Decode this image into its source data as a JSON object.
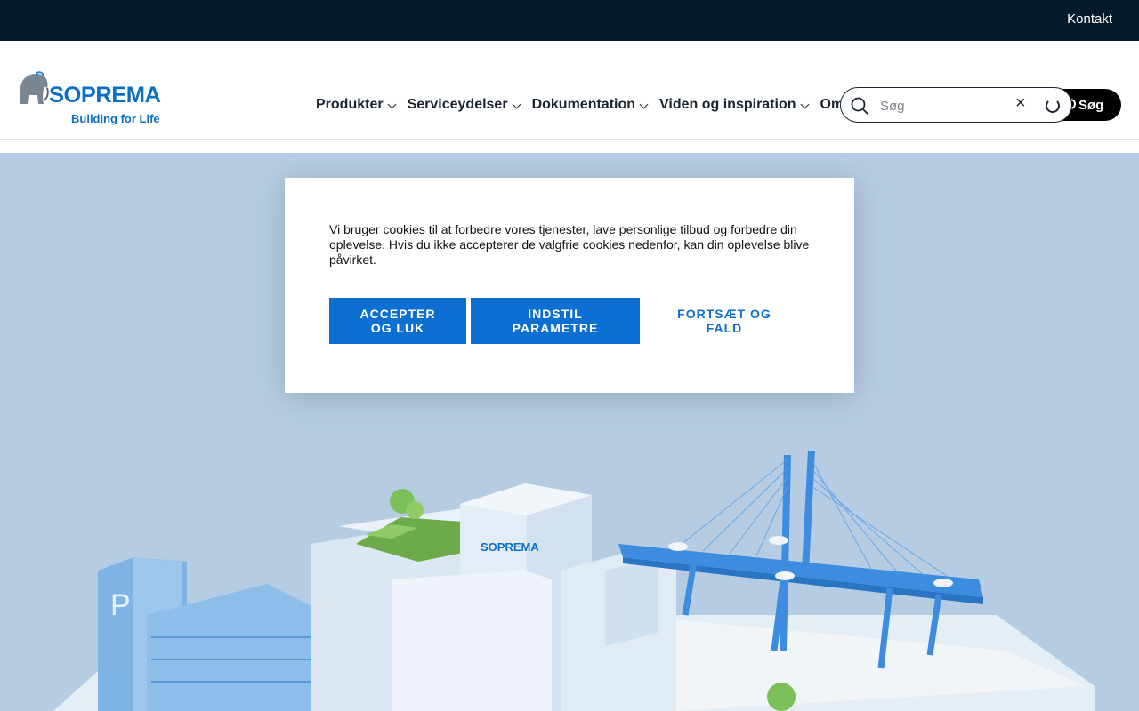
{
  "topbar": {
    "contact_label": "Kontakt"
  },
  "brand": {
    "name": "SOPREMA",
    "tagline": "Building for Life"
  },
  "nav": {
    "items": [
      {
        "label": "Produkter"
      },
      {
        "label": "Serviceydelser"
      },
      {
        "label": "Dokumentation"
      },
      {
        "label": "Viden og inspiration"
      },
      {
        "label": "Om"
      }
    ]
  },
  "search": {
    "placeholder": "Søg",
    "button_label": "Søg"
  },
  "hero": {
    "building_sign": "SOPREMA",
    "parking_sign": "P"
  },
  "cookie": {
    "text": "Vi bruger cookies til at forbedre vores tjenester, lave personlige tilbud og forbedre din oplevelse. Hvis du ikke accepterer de valgfrie cookies nedenfor, kan din oplevelse blive påvirket.",
    "accept_label": "Accepter og luk",
    "settings_label": "Indstil parametre",
    "continue_label": "Fortsæt og fald"
  },
  "colors": {
    "topbar": "#061a2b",
    "brand": "#0c6fc6",
    "button": "#0c6fd1",
    "hero_bg": "#b5cce2"
  }
}
